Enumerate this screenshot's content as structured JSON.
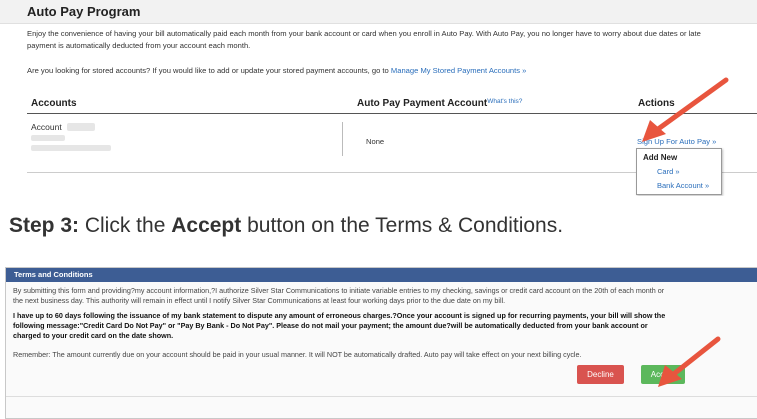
{
  "autopay": {
    "title": "Auto Pay Program",
    "description_line1": "Enjoy the convenience of having your bill automatically paid each month from your bank account or card when you enroll in Auto Pay. With Auto Pay, you no longer have to worry about due dates or late",
    "description_line2": "payment is automatically deducted from your account each month.",
    "stored_text": "Are you looking for stored accounts? If you would like to add or update your stored payment accounts, go to",
    "stored_link": "Manage My Stored Payment Accounts »",
    "columns": {
      "accounts": "Accounts",
      "payment_account": "Auto Pay Payment Account",
      "whats_this": "What's this?",
      "actions": "Actions"
    },
    "row": {
      "account_label": "Account",
      "payment_account_value": "None",
      "signup_link": "Sign Up For Auto Pay »"
    },
    "menu": {
      "header": "Add New",
      "card": "Card »",
      "bank_account": "Bank Account »"
    }
  },
  "step": {
    "prefix": "Step 3:",
    "text1": " Click the ",
    "bold": "Accept",
    "text2": " button on the Terms & Conditions."
  },
  "terms": {
    "title": "Terms and Conditions",
    "p1_line1": "By submitting this form and providing?my account information,?I authorize Silver Star Communications to initiate variable entries to my checking, savings or credit card account on the 20th of each month or",
    "p1_line2": "the next business day. This authority will remain in effect until I notify Silver Star Communications at least four working days prior to the due date on my bill.",
    "p2_line1": "I have up to 60 days following the issuance of my bank statement to dispute any amount of erroneous charges.?Once your account is signed up for recurring payments, your bill will show the",
    "p2_line2": "following message:\"Credit Card Do Not Pay\" or \"Pay By Bank - Do Not Pay\". Please do not mail your payment; the amount due?will be automatically deducted from your bank account or",
    "p2_line3": "charged to your credit card on the date shown.",
    "p3": "Remember: The amount currently due on your account should be paid in your usual manner. It will NOT be automatically drafted. Auto pay will take effect on your next billing cycle.",
    "decline_label": "Decline",
    "accept_label": "Accept"
  },
  "colors": {
    "link": "#2a6ebb",
    "terms_header": "#3d5d94",
    "decline": "#d9534f",
    "accept": "#5cb85c",
    "arrow": "#e8553e"
  }
}
